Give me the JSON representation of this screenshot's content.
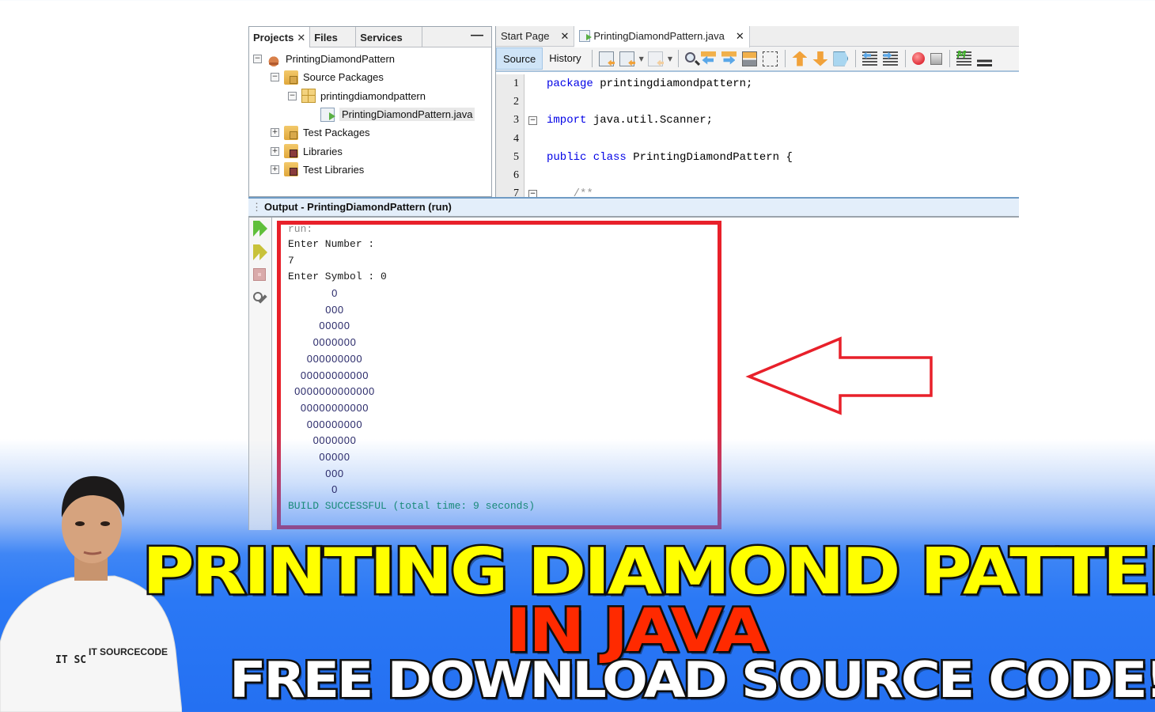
{
  "projects_panel": {
    "tabs": [
      {
        "label": "Projects",
        "close": "✕"
      },
      {
        "label": "Files"
      },
      {
        "label": "Services"
      }
    ],
    "minimize": "—",
    "tree": [
      {
        "label": "PrintingDiamondPattern",
        "toggle": "−",
        "icon": "project-cup-icon",
        "depth": 0
      },
      {
        "label": "Source Packages",
        "toggle": "−",
        "icon": "source-folder-icon",
        "depth": 1
      },
      {
        "label": "printingdiamondpattern",
        "toggle": "−",
        "icon": "package-icon",
        "depth": 2
      },
      {
        "label": "PrintingDiamondPattern.java",
        "toggle": "",
        "icon": "java-file-icon",
        "depth": 3,
        "selected": true
      },
      {
        "label": "Test Packages",
        "toggle": "+",
        "icon": "test-folder-icon",
        "depth": 1
      },
      {
        "label": "Libraries",
        "toggle": "+",
        "icon": "library-folder-icon",
        "depth": 1
      },
      {
        "label": "Test Libraries",
        "toggle": "+",
        "icon": "library-folder-icon",
        "depth": 1
      }
    ]
  },
  "editor": {
    "tabs": [
      {
        "label": "Start Page",
        "close": "✕"
      },
      {
        "label": "PrintingDiamondPattern.java",
        "close": "✕",
        "active": true
      }
    ],
    "toolbar": {
      "source": "Source",
      "history": "History",
      "icons": [
        "last-edit-icon",
        "back-icon",
        "forward-icon",
        "find-icon",
        "find-previous-icon",
        "find-next-icon",
        "toggle-highlight-icon",
        "rectangular-select-icon",
        "previous-bookmark-icon",
        "next-bookmark-icon",
        "toggle-bookmark-icon",
        "shift-left-icon",
        "shift-right-icon",
        "start-macro-icon",
        "stop-macro-icon",
        "comment-icon",
        "uncomment-icon"
      ]
    },
    "lines": [
      {
        "n": "1",
        "fold": "",
        "kw": "package",
        "rest": " printingdiamondpattern;"
      },
      {
        "n": "2",
        "fold": "",
        "kw": "",
        "rest": ""
      },
      {
        "n": "3",
        "fold": "−",
        "kw": "import",
        "rest": " java.util.Scanner;"
      },
      {
        "n": "4",
        "fold": "",
        "kw": "",
        "rest": ""
      },
      {
        "n": "5",
        "fold": "",
        "kw": "public class",
        "rest": " PrintingDiamondPattern {"
      },
      {
        "n": "6",
        "fold": "",
        "kw": "",
        "rest": ""
      },
      {
        "n": "7",
        "fold": "−",
        "kw": "",
        "rest": "",
        "comment": "    /**"
      }
    ]
  },
  "output": {
    "title": "Output - PrintingDiamondPattern (run)",
    "side_icons": [
      "rerun-icon",
      "rerun-with-args-icon",
      "stop-icon",
      "settings-icon"
    ],
    "run_label": "run:",
    "prompt_number": "Enter Number :",
    "input_number": "7",
    "prompt_symbol": "Enter Symbol : 0",
    "pattern": [
      "0",
      "000",
      "00000",
      "0000000",
      "000000000",
      "00000000000",
      "0000000000000",
      "00000000000",
      "000000000",
      "0000000",
      "00000",
      "000",
      "0"
    ],
    "result": "BUILD SUCCESSFUL (total time: 9 seconds)"
  },
  "annotation": {
    "highlight_color": "#e8202a",
    "arrow_color": "#e8202a"
  },
  "banner": {
    "line1": "PRINTING DIAMOND PATTERN",
    "line2": "IN JAVA",
    "line3": "FREE DOWNLOAD SOURCE CODE!",
    "shirt_brand": "IT SOURCECODE",
    "shirt_logo": "IT SC",
    "colors": {
      "line1": "#ffff00",
      "line2": "#ff2a00",
      "line3": "#ffffff",
      "background": "#2a78f5"
    }
  }
}
